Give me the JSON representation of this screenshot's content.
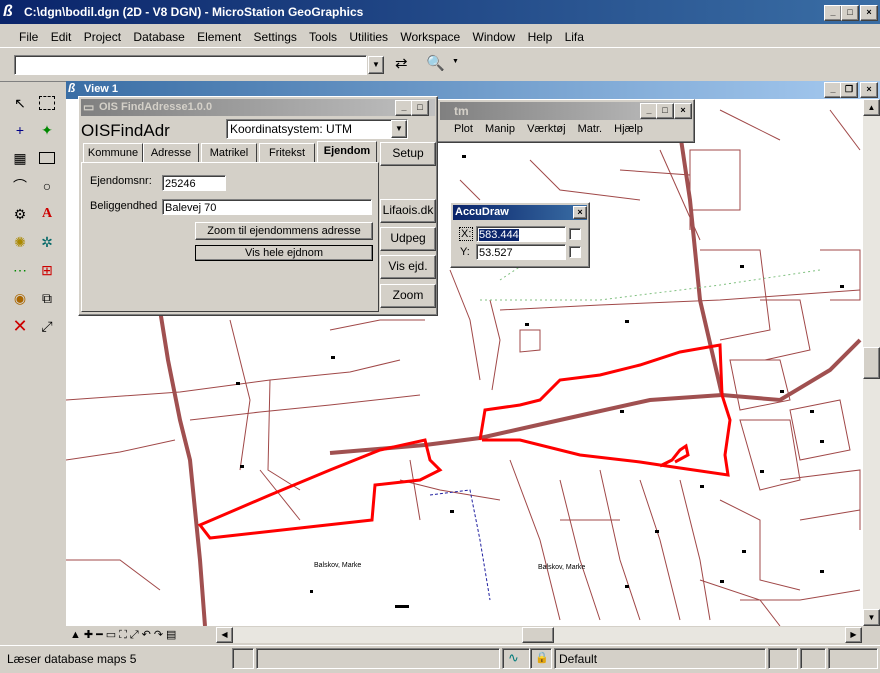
{
  "app": {
    "title": "C:\\dgn\\bodil.dgn (2D - V8 DGN) - MicroStation GeoGraphics"
  },
  "menu": [
    "File",
    "Edit",
    "Project",
    "Database",
    "Element",
    "Settings",
    "Tools",
    "Utilities",
    "Workspace",
    "Window",
    "Help",
    "Lifa"
  ],
  "view": {
    "title": "View 1"
  },
  "finder": {
    "title": "OIS FindAdresse1.0.0",
    "heading": "OISFindAdr",
    "coord_system": "Koordinatsystem: UTM",
    "tabs": [
      "Kommune",
      "Adresse",
      "Matrikel",
      "Fritekst",
      "Ejendom"
    ],
    "active_tab": "Ejendom",
    "ejendomsnr_label": "Ejendomsnr:",
    "ejendomsnr_value": "25246",
    "beliggenhed_label": "Beliggendhed",
    "beliggenhed_value": "Balevej 70",
    "zoom_btn": "Zoom til ejendommens adresse",
    "vis_btn": "Vis hele ejdnom",
    "side_buttons": [
      "Setup",
      "Lifaois.dk",
      "Udpeg",
      "Vis ejd.",
      "Zoom"
    ]
  },
  "utm_window": {
    "title_visible": "tm",
    "menu": [
      "Plot",
      "Manip",
      "Værktøj",
      "Matr.",
      "Hjælp"
    ]
  },
  "accudraw": {
    "title": "AccuDraw",
    "x_label": "X:",
    "x_value": "583.444",
    "y_label": "Y:",
    "y_value": "53.527"
  },
  "map_labels": [
    "Balskov, Marke",
    "Balskov, Marke"
  ],
  "status": {
    "message": "Læser database maps 5",
    "level": "Default"
  },
  "colors": {
    "title_active": "#0a246a",
    "map_red": "#ff0000",
    "map_brown": "#a05050"
  }
}
